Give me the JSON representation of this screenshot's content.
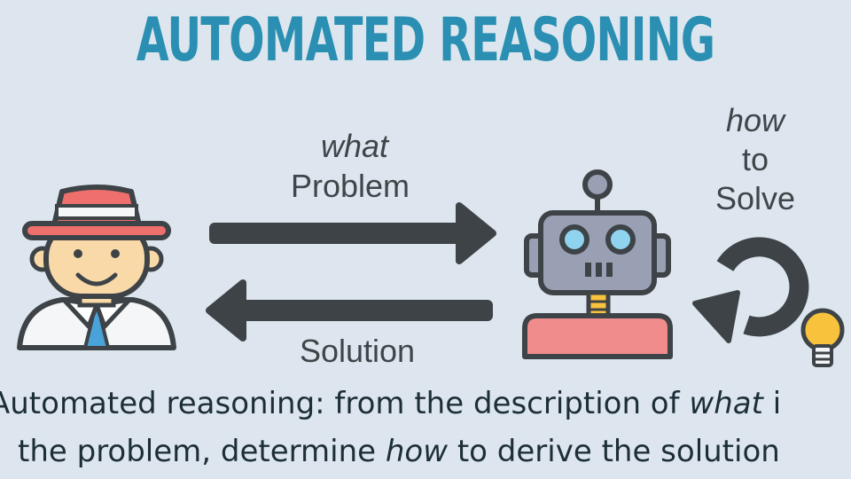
{
  "title": "AUTOMATED REASONING",
  "arrows": {
    "top_label_italic": "what",
    "top_label": "Problem",
    "bottom_label": "Solution"
  },
  "robot_loop": {
    "label_italic": "how",
    "label_line2": "to",
    "label_line3": "Solve"
  },
  "caption": {
    "line1_a": "Automated reasoning: from the description of ",
    "line1_b": "what",
    "line1_c": " i",
    "line2_a": "the problem, determine ",
    "line2_b": "how",
    "line2_c": " to derive the solution"
  },
  "colors": {
    "title": "#2a8fb2",
    "background": "#dde6ee",
    "arrow": "#3d4347",
    "robot_body": "#f08c8c",
    "robot_head": "#9aa0b4",
    "hat": "#ef6f6c",
    "skin": "#f9d9a8",
    "bulb": "#f9c23c"
  },
  "icons": [
    "detective-icon",
    "robot-icon",
    "cycle-arrow-icon",
    "lightbulb-icon"
  ]
}
